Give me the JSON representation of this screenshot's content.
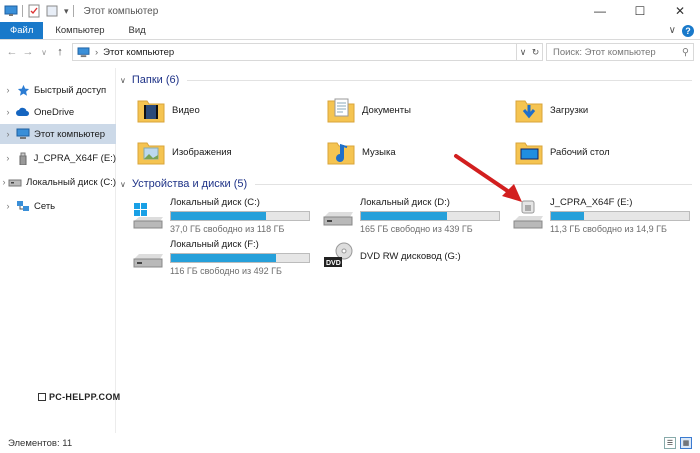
{
  "window": {
    "title": "Этот компьютер",
    "minimize": "—",
    "maximize": "☐",
    "close": "✕"
  },
  "ribbon": {
    "tabs": [
      "Файл",
      "Компьютер",
      "Вид"
    ],
    "expand": "∨",
    "help": "?"
  },
  "address": {
    "path": "Этот компьютер",
    "search_placeholder": "Поиск: Этот компьютер"
  },
  "sidebar": {
    "items": [
      {
        "label": "Быстрый доступ",
        "icon": "star-icon"
      },
      {
        "label": "OneDrive",
        "icon": "cloud-icon"
      },
      {
        "label": "Этот компьютер",
        "icon": "computer-icon",
        "selected": true
      },
      {
        "label": "J_CPRA_X64F (E:)",
        "icon": "usb-drive-icon"
      },
      {
        "label": "Локальный диск (C:)",
        "icon": "hard-drive-icon"
      },
      {
        "label": "Сеть",
        "icon": "network-icon"
      }
    ]
  },
  "folders": {
    "header": "Папки (6)",
    "items": [
      {
        "label": "Видео",
        "icon": "video-folder-icon"
      },
      {
        "label": "Документы",
        "icon": "documents-folder-icon"
      },
      {
        "label": "Загрузки",
        "icon": "downloads-folder-icon"
      },
      {
        "label": "Изображения",
        "icon": "pictures-folder-icon"
      },
      {
        "label": "Музыка",
        "icon": "music-folder-icon"
      },
      {
        "label": "Рабочий стол",
        "icon": "desktop-folder-icon"
      }
    ]
  },
  "devices": {
    "header": "Устройства и диски (5)",
    "items": [
      {
        "name": "Локальный диск (C:)",
        "free": "37,0 ГБ свободно из 118 ГБ",
        "used_fraction": 0.69,
        "icon": "windows-drive-icon"
      },
      {
        "name": "Локальный диск (D:)",
        "free": "165 ГБ свободно из 439 ГБ",
        "used_fraction": 0.62,
        "icon": "hard-drive-icon"
      },
      {
        "name": "J_CPRA_X64F (E:)",
        "free": "11,3 ГБ свободно из 14,9 ГБ",
        "used_fraction": 0.24,
        "icon": "usb-drive-icon"
      },
      {
        "name": "Локальный диск (F:)",
        "free": "116 ГБ свободно из 492 ГБ",
        "used_fraction": 0.76,
        "icon": "hard-drive-icon"
      },
      {
        "name": "DVD RW дисковод (G:)",
        "icon": "dvd-drive-icon"
      }
    ]
  },
  "watermark": "PC-HELPP.COM",
  "status": {
    "count": "Элементов: 11"
  },
  "colors": {
    "accent": "#1979ca",
    "progress": "#26a0da",
    "selection": "#ccd9e8",
    "arrow": "#d21f1f"
  }
}
